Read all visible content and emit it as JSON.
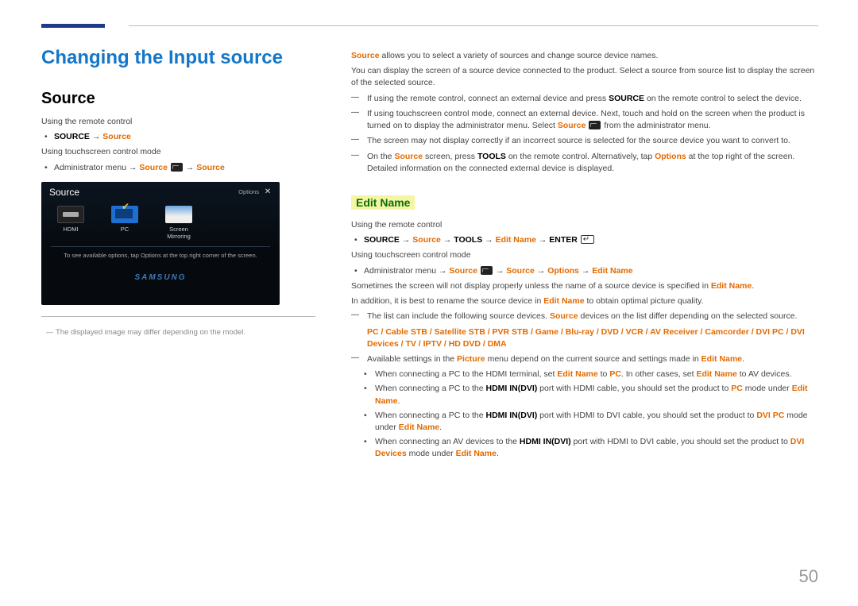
{
  "page_number": "50",
  "title": "Changing the Input source",
  "left": {
    "subtitle": "Source",
    "using_remote": "Using the remote control",
    "source_btn": "SOURCE",
    "arrow": "→",
    "source_word": "Source",
    "using_touch": "Using touchscreen control mode",
    "admin_menu": "Administrator menu",
    "panel": {
      "title": "Source",
      "options": "Options",
      "close": "✕",
      "items": [
        {
          "label": "HDMI"
        },
        {
          "label": "PC"
        },
        {
          "label": "Screen Mirroring"
        }
      ],
      "hint": "To see available options, tap Options at the top right corner of the screen.",
      "logo": "SAMSUNG"
    },
    "footnote": "The displayed image may differ depending on the model."
  },
  "right": {
    "intro_src_bold": "Source",
    "intro_rest": " allows you to select a variety of sources and change source device names.",
    "p2": "You can display the screen of a source device connected to the product. Select a source from source list to display the screen of the selected source.",
    "dash": {
      "d1_a": "If using the remote control, connect an external device and press ",
      "d1_b": "SOURCE",
      "d1_c": " on the remote control to select the device.",
      "d2_a": "If using touchscreen control mode, connect an external device. Next, touch and hold on the screen when the product is turned on to display the administrator menu. Select ",
      "d2_b": "Source",
      "d2_c": " from the administrator menu.",
      "d3": "The screen may not display correctly if an incorrect source is selected for the source device you want to convert to.",
      "d4_a": "On the ",
      "d4_b": "Source",
      "d4_c": " screen, press ",
      "d4_d": "TOOLS",
      "d4_e": " on the remote control. Alternatively, tap ",
      "d4_f": "Options",
      "d4_g": " at the top right of the screen. Detailed information on the connected external device is displayed."
    },
    "edit_name_heading": "Edit Name",
    "en_using_remote": "Using the remote control",
    "en_path1": {
      "a": "SOURCE",
      "b": "Source",
      "c": "TOOLS",
      "d": "Edit Name",
      "e": "ENTER"
    },
    "en_using_touch": "Using touchscreen control mode",
    "en_path2": {
      "a": "Administrator menu",
      "b": "Source",
      "c": "Source",
      "d": "Options",
      "e": "Edit Name"
    },
    "sometimes_a": "Sometimes the screen will not display properly unless the name of a source device is specified in ",
    "sometimes_b": "Edit Name",
    "sometimes_c": ".",
    "inaddition_a": "In addition, it is best to rename the source device in ",
    "inaddition_b": "Edit Name",
    "inaddition_c": " to obtain optimal picture quality.",
    "listcan_a": "The list can include the following source devices. ",
    "listcan_b": "Source",
    "listcan_c": " devices on the list differ depending on the selected source.",
    "devices": "PC / Cable STB / Satellite STB / PVR STB / Game / Blu-ray / DVD / VCR / AV Receiver / Camcorder / DVI PC / DVI Devices / TV / IPTV / HD DVD / DMA",
    "avail_a": "Available settings in the ",
    "avail_b": "Picture",
    "avail_c": " menu depend on the current source and settings made in ",
    "avail_d": "Edit Name",
    "avail_e": ".",
    "b1_a": "When connecting a PC to the HDMI terminal, set ",
    "b1_b": "Edit Name",
    "b1_c": " to ",
    "b1_d": "PC",
    "b1_e": ". In other cases, set ",
    "b1_f": "Edit Name",
    "b1_g": " to AV devices.",
    "b2_a": "When connecting a PC to the ",
    "b2_b": "HDMI IN(DVI)",
    "b2_c": " port with HDMI cable, you should set the product to ",
    "b2_d": "PC",
    "b2_e": " mode under ",
    "b2_f": "Edit Name",
    "b2_g": ".",
    "b3_a": "When connecting a PC to the ",
    "b3_b": "HDMI IN(DVI)",
    "b3_c": " port with HDMI to DVI cable, you should set the product to ",
    "b3_d": "DVI PC",
    "b3_e": " mode under ",
    "b3_f": "Edit Name",
    "b3_g": ".",
    "b4_a": "When connecting an AV devices to the ",
    "b4_b": "HDMI IN(DVI)",
    "b4_c": " port with HDMI to DVI cable, you should set the product to ",
    "b4_d": "DVI Devices",
    "b4_e": " mode under ",
    "b4_f": "Edit Name",
    "b4_g": "."
  }
}
